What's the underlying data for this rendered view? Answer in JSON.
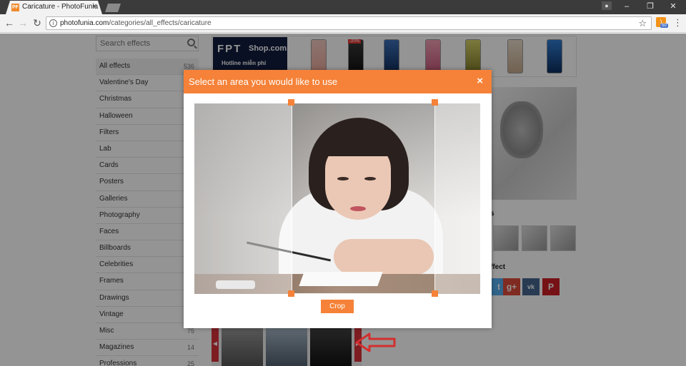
{
  "browser": {
    "tab_favicon": "PF",
    "tab_title": "Caricature - PhotoFunia",
    "tab_close": "×",
    "url_domain": "photofunia.com",
    "url_path": "/categories/all_effects/caricature",
    "rss_badge": "50",
    "window_buttons": [
      "–",
      "❐",
      "✕"
    ],
    "nav": {
      "back": "←",
      "forward": "→",
      "reload": "↻",
      "star": "☆",
      "menu": "⋮"
    }
  },
  "sidebar": {
    "search_placeholder": "Search effects",
    "categories": [
      {
        "label": "All effects",
        "count": "536"
      },
      {
        "label": "Valentine's Day",
        "count": ""
      },
      {
        "label": "Christmas",
        "count": ""
      },
      {
        "label": "Halloween",
        "count": ""
      },
      {
        "label": "Filters",
        "count": ""
      },
      {
        "label": "Lab",
        "count": ""
      },
      {
        "label": "Cards",
        "count": ""
      },
      {
        "label": "Posters",
        "count": ""
      },
      {
        "label": "Galleries",
        "count": ""
      },
      {
        "label": "Photography",
        "count": ""
      },
      {
        "label": "Faces",
        "count": ""
      },
      {
        "label": "Billboards",
        "count": ""
      },
      {
        "label": "Celebrities",
        "count": ""
      },
      {
        "label": "Frames",
        "count": ""
      },
      {
        "label": "Drawings",
        "count": ""
      },
      {
        "label": "Vintage",
        "count": ""
      },
      {
        "label": "Misc",
        "count": "75"
      },
      {
        "label": "Magazines",
        "count": "14"
      },
      {
        "label": "Professions",
        "count": "25"
      }
    ]
  },
  "banner": {
    "logo_fpt": "FPT",
    "logo_shop": "Shop.com.vn",
    "hotline": "Hotline miễn phí",
    "discount_badge": "-20%"
  },
  "right_column": {
    "heading_examples": "s",
    "heading_share": "ffect",
    "share_buttons": [
      "t",
      "g+",
      "vk",
      "P"
    ]
  },
  "modal": {
    "title": "Select an area you would like to use",
    "close": "×",
    "crop_label": "Crop"
  },
  "colors": {
    "accent": "#f58238",
    "annotation_red": "#d32f2f",
    "pinterest": "#cb2027",
    "gplus": "#dd4b39",
    "vk": "#45668e",
    "twitter": "#55acee"
  }
}
